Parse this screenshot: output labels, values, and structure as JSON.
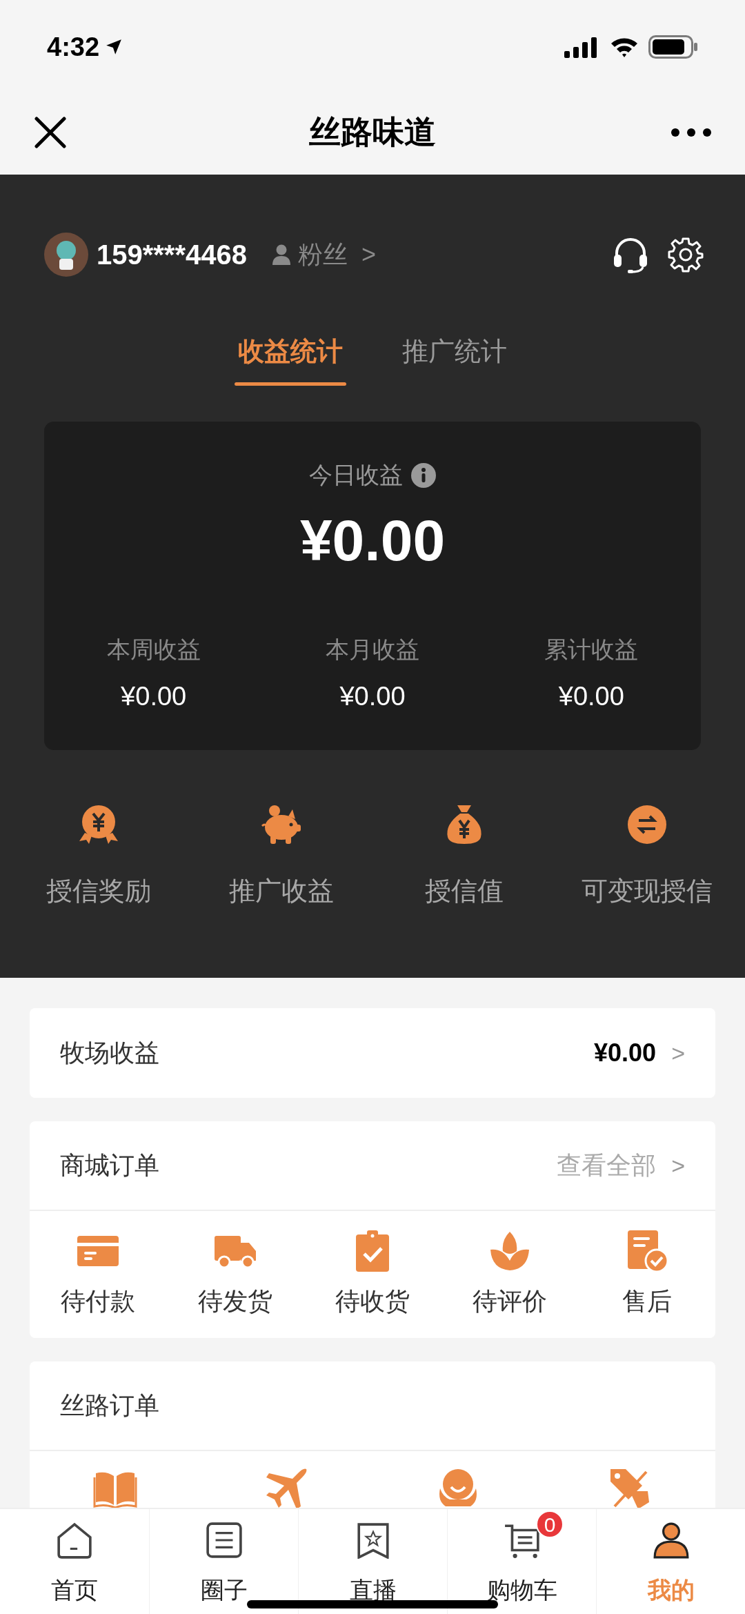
{
  "status_bar": {
    "time": "4:32"
  },
  "nav": {
    "title": "丝路味道"
  },
  "profile": {
    "phone": "159****4468",
    "fans_label": "粉丝",
    "arrow": ">"
  },
  "tabs": [
    {
      "label": "收益统计",
      "selected": true
    },
    {
      "label": "推广统计",
      "selected": false
    }
  ],
  "today": {
    "label": "今日收益",
    "amount": "¥0.00"
  },
  "stats": [
    {
      "label": "本周收益",
      "value": "¥0.00"
    },
    {
      "label": "本月收益",
      "value": "¥0.00"
    },
    {
      "label": "累计收益",
      "value": "¥0.00"
    }
  ],
  "shortcuts": [
    {
      "label": "授信奖励",
      "kind": "medal"
    },
    {
      "label": "推广收益",
      "kind": "piggy"
    },
    {
      "label": "授信值",
      "kind": "moneybag"
    },
    {
      "label": "可变现授信",
      "kind": "exchange"
    }
  ],
  "farm": {
    "label": "牧场收益",
    "value": "¥0.00",
    "arrow": ">"
  },
  "mall_orders": {
    "title": "商城订单",
    "link": "查看全部",
    "arrow": ">",
    "items": [
      {
        "label": "待付款",
        "kind": "card"
      },
      {
        "label": "待发货",
        "kind": "truck"
      },
      {
        "label": "待收货",
        "kind": "clipboard"
      },
      {
        "label": "待评价",
        "kind": "flower"
      },
      {
        "label": "售后",
        "kind": "doc"
      }
    ]
  },
  "silk_orders": {
    "title": "丝路订单",
    "items": [
      {
        "kind": "book"
      },
      {
        "kind": "plane"
      },
      {
        "kind": "smile"
      },
      {
        "kind": "tag"
      }
    ]
  },
  "tab_bar": [
    {
      "label": "首页",
      "kind": "home",
      "selected": false
    },
    {
      "label": "圈子",
      "kind": "list",
      "selected": false
    },
    {
      "label": "直播",
      "kind": "bookmark",
      "selected": false
    },
    {
      "label": "购物车",
      "kind": "cart",
      "selected": false,
      "badge": "0"
    },
    {
      "label": "我的",
      "kind": "person",
      "selected": true
    }
  ]
}
